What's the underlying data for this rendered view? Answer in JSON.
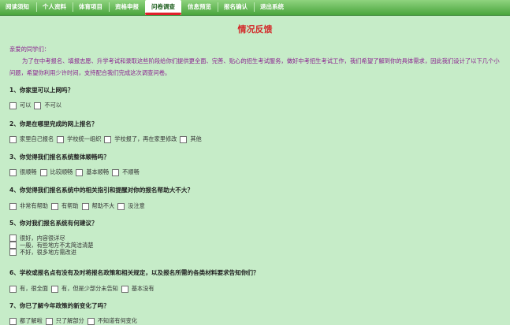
{
  "nav": {
    "items": [
      {
        "label": "阅读须知"
      },
      {
        "label": "个人资料"
      },
      {
        "label": "体育项目"
      },
      {
        "label": "资格申报"
      },
      {
        "label": "问卷调查"
      },
      {
        "label": "信息预览"
      },
      {
        "label": "报名确认"
      },
      {
        "label": "退出系统"
      }
    ],
    "active_index": 4,
    "active_underline_color": "#e0202a"
  },
  "page": {
    "title": "情况反馈",
    "greeting": "亲爱的同学们：",
    "intro": "为了在中考报名、填报志愿、升学考试和录取这些阶段给你们提供更全面、完善、贴心的招生考试服务，做好中考招生考试工作，我们希望了解到你的具体需求，因此我们设计了以下几个小问题，希望你利用少许时间，支持配合我们完成这次调查问卷。"
  },
  "questions": [
    {
      "text": "1、你家里可以上网吗？",
      "options": [
        "可以",
        "不可以"
      ]
    },
    {
      "text": "2、你是在哪里完成的网上报名？",
      "options": [
        "家里自己报名",
        "学校统一组织",
        "学校报了，再在家里修改",
        "其他"
      ]
    },
    {
      "text": "3、你觉得我们报名系统整体顺畅吗？",
      "options": [
        "很顺畅",
        "比较顺畅",
        "基本顺畅",
        "不顺畅"
      ]
    },
    {
      "text": "4、你觉得我们报名系统中的相关指引和提醒对你的报名帮助大不大？",
      "options": [
        "非常有帮助",
        "有帮助",
        "帮助不大",
        "没注意"
      ]
    },
    {
      "text": "5、你对我们报名系统有何建议？",
      "options": [
        "很好，内容很详尽",
        "一般，有些地方不太简洁清楚",
        "不好，很多地方需改进"
      ]
    },
    {
      "text": "6、学校或报名点有没有及时将报名政策和相关规定，以及报名所需的各类材料要求告知你们？",
      "options": [
        "有，很全面",
        "有，但是少部分未告知",
        "基本没有"
      ]
    },
    {
      "text": "7、你已了解今年政策的新变化了吗？",
      "options": [
        "都了解啦",
        "只了解部分",
        "不知道有何变化"
      ]
    }
  ]
}
